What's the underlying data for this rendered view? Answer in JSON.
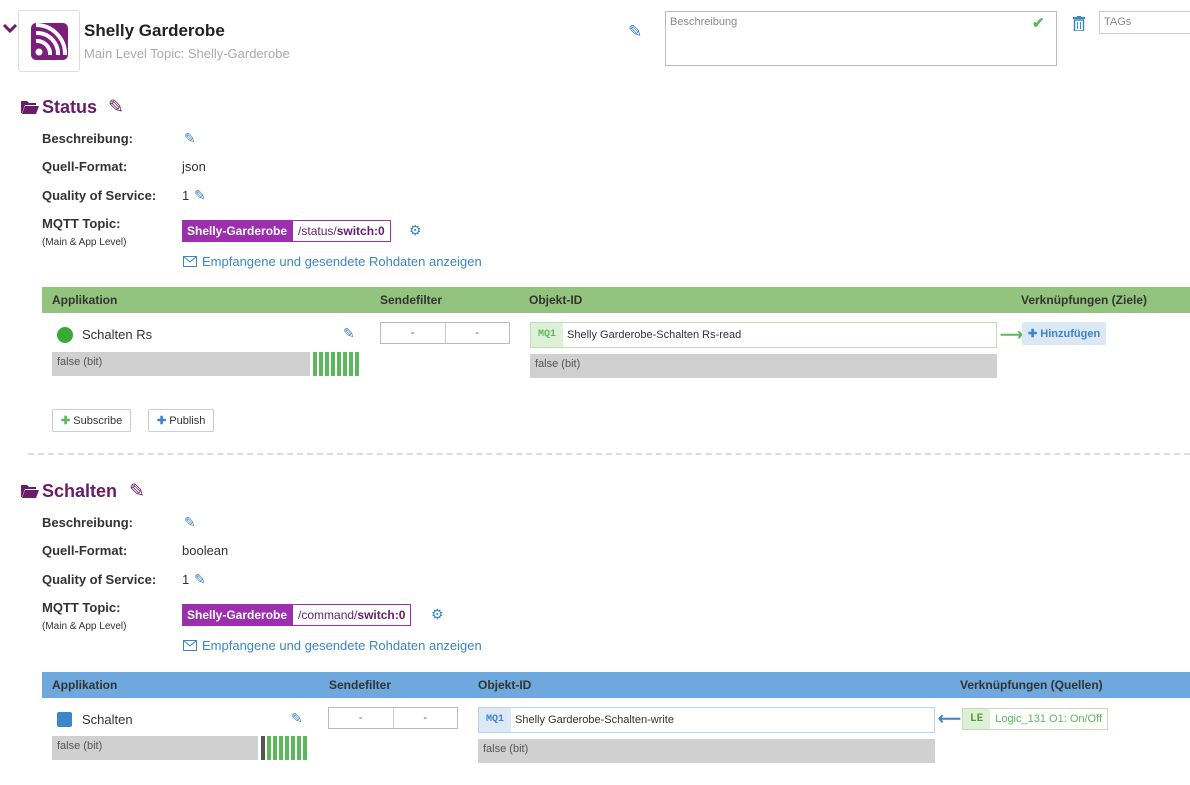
{
  "header": {
    "title": "Shelly Garderobe",
    "subtitle": "Main Level Topic: Shelly-Garderobe",
    "description_placeholder": "Beschreibung",
    "tags_placeholder": "TAGs"
  },
  "status": {
    "title": "Status",
    "beschreibung_label": "Beschreibung:",
    "format_label": "Quell-Format:",
    "format_value": "json",
    "qos_label": "Quality of Service:",
    "qos_value": "1",
    "mqtt_label": "MQTT Topic:",
    "mqtt_sub": "(Main & App Level)",
    "topic_main": "Shelly-Garderobe",
    "topic_path": "/status/",
    "topic_bold": "switch:0",
    "raw_link": "Empfangene und gesendete Rohdaten anzeigen",
    "table": {
      "col_app": "Applikation",
      "col_filter": "Sendefilter",
      "col_obj": "Objekt-ID",
      "col_links": "Verknüpfungen (Ziele)",
      "app_name": "Schalten Rs",
      "app_value": "false (bit)",
      "filter_a": "-",
      "filter_b": "-",
      "obj_tag": "MQ1",
      "obj_name": "Shelly Garderobe-Schalten Rs-read",
      "obj_value": "false (bit)",
      "add_label": "Hinzufügen"
    },
    "subscribe_label": "Subscribe",
    "publish_label": "Publish"
  },
  "schalten": {
    "title": "Schalten",
    "beschreibung_label": "Beschreibung:",
    "format_label": "Quell-Format:",
    "format_value": "boolean",
    "qos_label": "Quality of Service:",
    "qos_value": "1",
    "mqtt_label": "MQTT Topic:",
    "mqtt_sub": "(Main & App Level)",
    "topic_main": "Shelly-Garderobe",
    "topic_path": "/command/",
    "topic_bold": "switch:0",
    "raw_link": "Empfangene und gesendete Rohdaten anzeigen",
    "table": {
      "col_app": "Applikation",
      "col_filter": "Sendefilter",
      "col_obj": "Objekt-ID",
      "col_links": "Verknüpfungen (Quellen)",
      "app_name": "Schalten",
      "app_value": "false (bit)",
      "filter_a": "-",
      "filter_b": "-",
      "obj_tag": "MQ1",
      "obj_name": "Shelly Garderobe-Schalten-write",
      "obj_value": "false (bit)",
      "logic_tag": "LE",
      "logic_name": "Logic_131 O1: On/Off"
    }
  },
  "colors": {
    "purple": "#6a1b6a",
    "topic_purple": "#9b2fae",
    "status_header": "#93c47d",
    "schalten_header": "#6fa8dc",
    "green": "#5cb85c",
    "blue": "#3a86c8"
  }
}
